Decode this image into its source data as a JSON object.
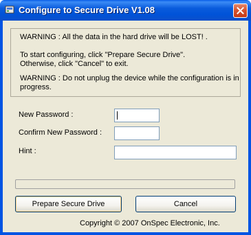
{
  "window": {
    "title": "Configure to Secure Drive V1.08"
  },
  "warning": {
    "line1": "WARNING : All the data in the hard drive will be LOST! .",
    "line2": "To start configuring, click \"Prepare Secure Drive\".",
    "line3": "Otherwise, click \"Cancel\" to exit.",
    "line4": "WARNING : Do not unplug the device while the configuration is in",
    "line5": "progress."
  },
  "form": {
    "new_password_label": "New Password :",
    "new_password_value": "",
    "confirm_password_label": "Confirm New Password :",
    "confirm_password_value": "",
    "hint_label": "Hint  :",
    "hint_value": ""
  },
  "progress": {
    "value": 0
  },
  "buttons": {
    "prepare_label": "Prepare Secure Drive",
    "cancel_label": "Cancel"
  },
  "footer": {
    "copyright": "Copyright © 2007 OnSpec Electronic, Inc."
  },
  "colors": {
    "titlebar": "#0054e3",
    "client": "#ece9d8",
    "close": "#d8542f"
  }
}
